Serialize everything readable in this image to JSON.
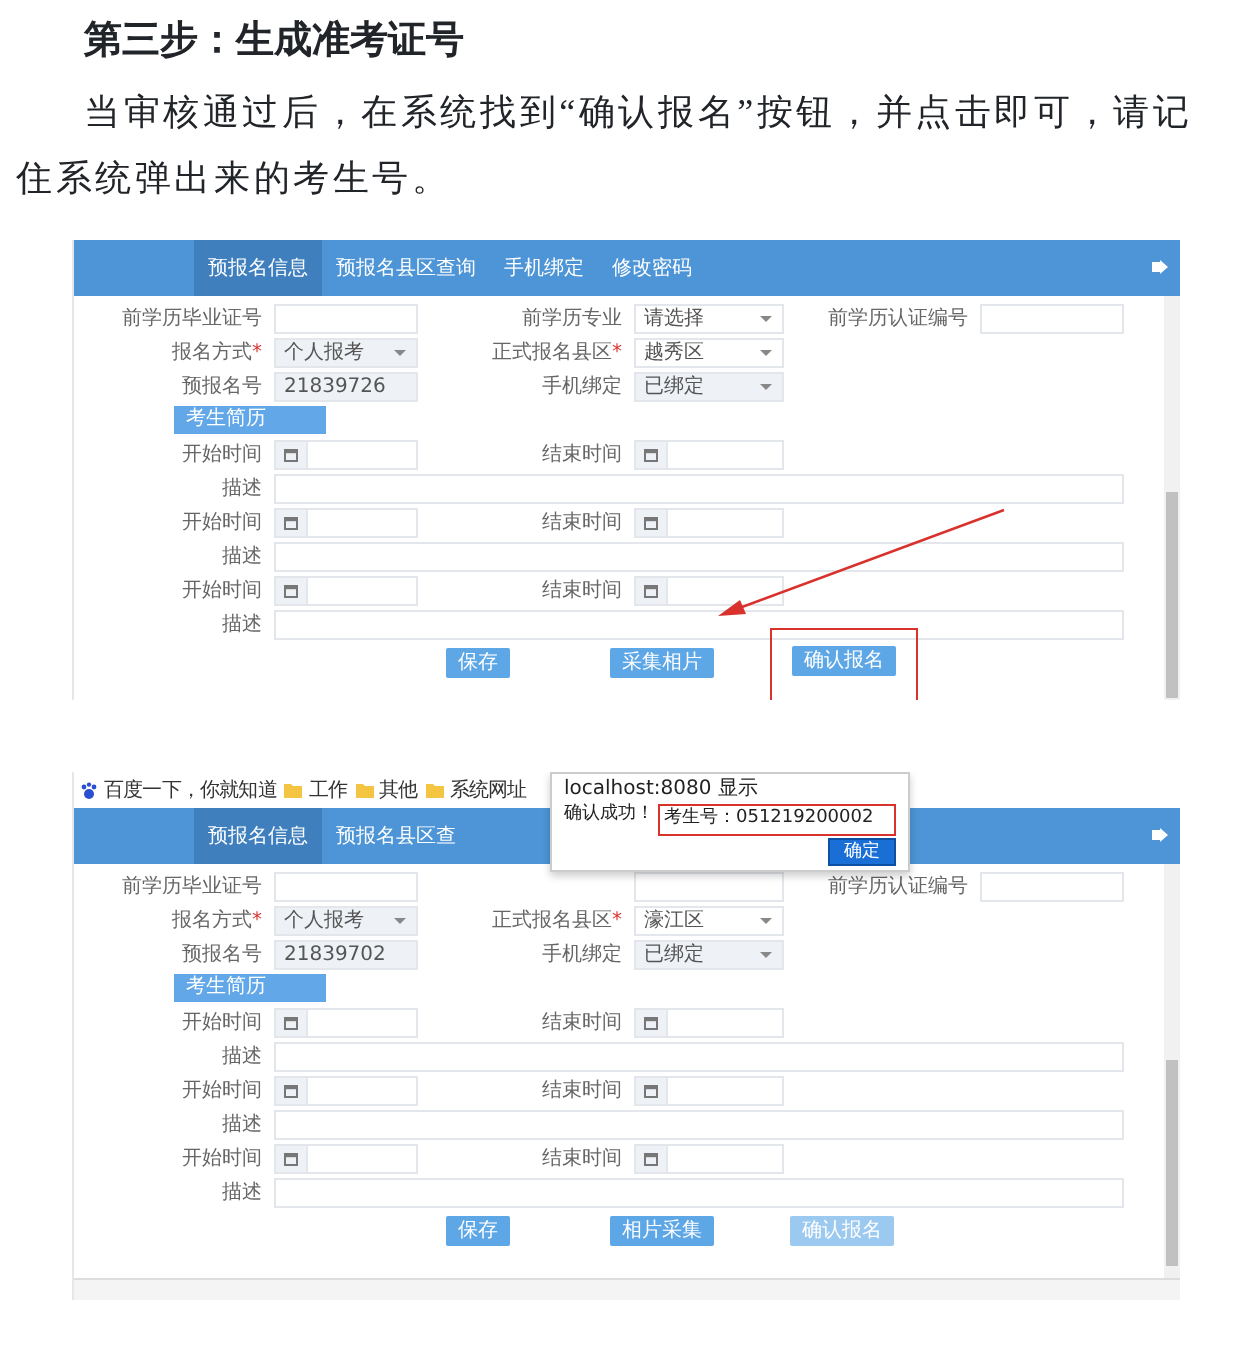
{
  "heading": "第三步：生成准考证号",
  "paragraph": "当审核通过后，在系统找到“确认报名”按钮，并点击即可，请记住系统弹出来的考生号。",
  "screens": [
    {
      "arrow": true,
      "nav": [
        {
          "label": "预报名信息",
          "selected": true
        },
        {
          "label": "预报名县区查询",
          "selected": false
        },
        {
          "label": "手机绑定",
          "selected": false
        },
        {
          "label": "修改密码",
          "selected": false
        }
      ],
      "field_rows": [
        [
          {
            "kind": "input",
            "label": "前学历毕业证号",
            "disabled": false
          },
          {
            "kind": "select",
            "label": "前学历专业",
            "value": "请选择",
            "disabled": false
          },
          {
            "kind": "input",
            "label": "前学历认证编号",
            "disabled": false
          }
        ],
        [
          {
            "kind": "select",
            "label": "报名方式",
            "mark": "*",
            "value": "个人报考",
            "disabled": true
          },
          {
            "kind": "select",
            "label": "正式报名县区",
            "mark": "*",
            "value": "越秀区",
            "disabled": false
          }
        ],
        [
          {
            "kind": "input",
            "label": "预报名号",
            "value": "21839726",
            "disabled": true
          },
          {
            "kind": "select",
            "label": "手机绑定",
            "value": "已绑定",
            "disabled": true
          }
        ]
      ],
      "section": "考生简历",
      "history": [
        {
          "start": "开始时间",
          "end": "结束时间",
          "desc": "描述"
        },
        {
          "start": "开始时间",
          "end": "结束时间",
          "desc": "描述"
        },
        {
          "start": "开始时间",
          "end": "结束时间",
          "desc": "描述"
        }
      ],
      "buttons": [
        {
          "label": "保存",
          "disabled": false,
          "highlighted": false
        },
        {
          "label": "采集相片",
          "disabled": false,
          "highlighted": false
        },
        {
          "label": "确认报名",
          "disabled": false,
          "highlighted": true
        }
      ]
    },
    {
      "arrow": false,
      "bookmarks": [
        {
          "kind": "site",
          "label": "百度一下，你就知道"
        },
        {
          "kind": "folder",
          "label": "工作"
        },
        {
          "kind": "folder",
          "label": "其他"
        },
        {
          "kind": "folder",
          "label": "系统网址"
        }
      ],
      "dialog": {
        "title": "localhost:8080 显示",
        "message": "确认成功！",
        "detail": "考生号：051219200002",
        "highlighted": true,
        "button": "确定"
      },
      "nav": [
        {
          "label": "预报名信息",
          "selected": true
        },
        {
          "label": "预报名县区查",
          "selected": false
        }
      ],
      "field_rows": [
        [
          {
            "kind": "input",
            "label": "前学历毕业证号",
            "disabled": false
          },
          {
            "kind": "covered"
          },
          {
            "kind": "input",
            "label": "前学历认证编号",
            "disabled": false
          }
        ],
        [
          {
            "kind": "select",
            "label": "报名方式",
            "mark": "*",
            "value": "个人报考",
            "disabled": true
          },
          {
            "kind": "select",
            "label": "正式报名县区",
            "mark": "*",
            "value": "濠江区",
            "disabled": false
          }
        ],
        [
          {
            "kind": "input",
            "label": "预报名号",
            "value": "21839702",
            "disabled": true
          },
          {
            "kind": "select",
            "label": "手机绑定",
            "value": "已绑定",
            "disabled": true
          }
        ]
      ],
      "section": "考生简历",
      "history": [
        {
          "start": "开始时间",
          "end": "结束时间",
          "desc": "描述"
        },
        {
          "start": "开始时间",
          "end": "结束时间",
          "desc": "描述"
        },
        {
          "start": "开始时间",
          "end": "结束时间",
          "desc": "描述"
        }
      ],
      "buttons": [
        {
          "label": "保存",
          "disabled": false,
          "highlighted": false
        },
        {
          "label": "相片采集",
          "disabled": false,
          "highlighted": false
        },
        {
          "label": "确认报名",
          "disabled": true,
          "highlighted": false
        }
      ]
    }
  ]
}
